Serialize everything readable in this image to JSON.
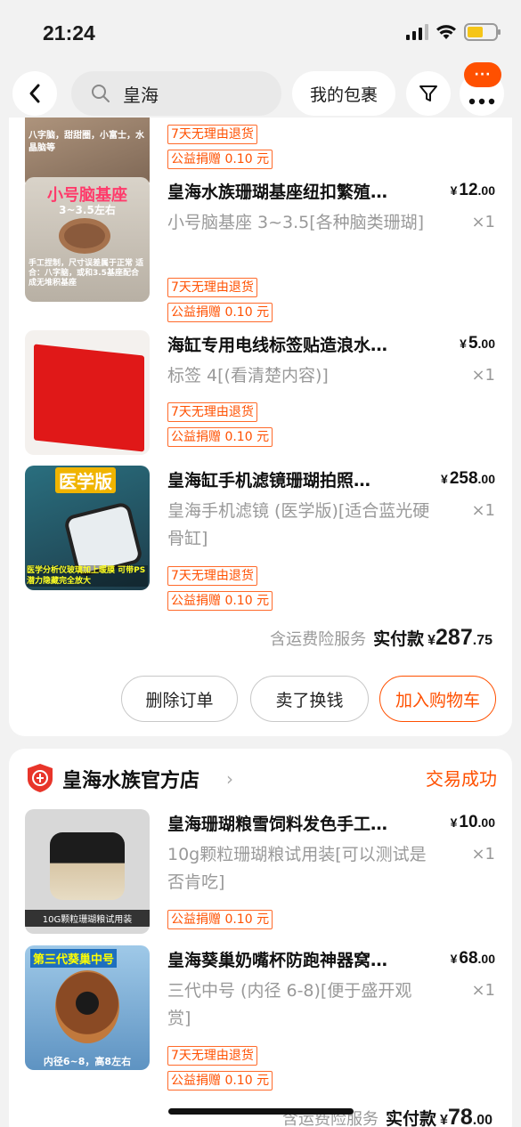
{
  "status_bar": {
    "time": "21:24",
    "battery_level": 0.55
  },
  "nav": {
    "search_value": "皇海",
    "package_button": "我的包裹",
    "badge_text": "···"
  },
  "order1": {
    "top_tags": [
      "7天无理由退货",
      "公益捐赠 0.10 元"
    ],
    "top_thumb_text": "八字脑，甜甜圈，小富士，水晶脑等",
    "items": [
      {
        "title": "皇海水族珊瑚基座纽扣繁殖…",
        "price_currency": "¥",
        "price_int": "12",
        "price_dec": ".00",
        "spec": "小号脑基座 3~3.5[各种脑类珊瑚]",
        "qty": "×1",
        "tags": [
          "7天无理由退货",
          "公益捐赠 0.10 元"
        ],
        "thumb_title": "小号脑基座",
        "thumb_sub": "3~3.5左右",
        "thumb_note": "手工捏制，尺寸误差属于正常 适合：八字脑，或和3.5基座配合成无堆积基座"
      },
      {
        "title": "海缸专用电线标签贴造浪水…",
        "price_currency": "¥",
        "price_int": "5",
        "price_dec": ".00",
        "spec": "标签 4[(看清楚内容)]",
        "qty": "×1",
        "tags": [
          "7天无理由退货",
          "公益捐赠 0.10 元"
        ]
      },
      {
        "title": "皇海缸手机滤镜珊瑚拍照…",
        "price_currency": "¥",
        "price_int": "258",
        "price_dec": ".00",
        "spec": "皇海手机滤镜 (医学版)[适合蓝光硬骨缸]",
        "qty": "×1",
        "tags": [
          "7天无理由退货",
          "公益捐赠 0.10 元"
        ],
        "thumb_title": "医学版",
        "thumb_note": "医学分析仪玻璃加上暖膜 可带PS潜力隐藏完全放大"
      }
    ],
    "total": {
      "note": "含运费险服务",
      "label": "实付款",
      "currency": "¥",
      "int": "287",
      "dec": ".75"
    },
    "buttons": [
      "删除订单",
      "卖了换钱",
      "加入购物车"
    ]
  },
  "order2": {
    "shop_name": "皇海水族官方店",
    "status": "交易成功",
    "items": [
      {
        "title": "皇海珊瑚粮雪饲料发色手工…",
        "price_currency": "¥",
        "price_int": "10",
        "price_dec": ".00",
        "spec": "10g颗粒珊瑚粮试用装[可以测试是否肯吃]",
        "qty": "×1",
        "tags": [
          "公益捐赠 0.10 元"
        ],
        "thumb_caption": "10G颗粒珊瑚粮试用装"
      },
      {
        "title": "皇海葵巢奶嘴杯防跑神器窝…",
        "price_currency": "¥",
        "price_int": "68",
        "price_dec": ".00",
        "spec": "三代中号 (内径 6-8)[便于盛开观赏]",
        "qty": "×1",
        "tags": [
          "7天无理由退货",
          "公益捐赠 0.10 元"
        ],
        "thumb_title": "第三代葵巢中号",
        "thumb_note": "内径6~8，高8左右"
      }
    ],
    "total": {
      "note": "含运费险服务",
      "label": "实付款",
      "currency": "¥",
      "int": "78",
      "dec": ".00"
    }
  }
}
